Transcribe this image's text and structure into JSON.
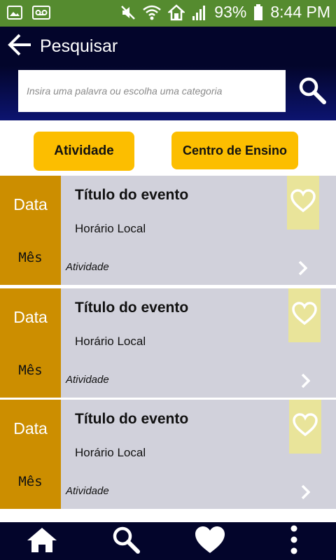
{
  "status_bar": {
    "battery": "93%",
    "time": "8:44 PM",
    "left_icons": [
      "image-icon",
      "voicemail-icon"
    ],
    "right_icons": [
      "mute-icon",
      "wifi-icon",
      "home-icon",
      "signal-icon",
      "battery-icon"
    ],
    "background": "#558b2f"
  },
  "app_bar": {
    "title": "Pesquisar",
    "back_icon": "arrow-left-icon",
    "background": "#03052b"
  },
  "search": {
    "placeholder": "Insira uma palavra ou escolha uma categoria",
    "value": "",
    "button_icon": "search-icon"
  },
  "filters": {
    "atividade_label": "Atividade",
    "centro_label": "Centro de Ensino",
    "accent": "#fcbe00"
  },
  "events": [
    {
      "day": "Data",
      "month": "Mês",
      "title": "Título do evento",
      "time_place": "Horário Local",
      "category": "Atividade",
      "favorite": false
    },
    {
      "day": "Data",
      "month": "Mês",
      "title": "Título do evento",
      "time_place": "Horário Local",
      "category": "Atividade",
      "favorite": false
    },
    {
      "day": "Data",
      "month": "Mês",
      "title": "Título do evento",
      "time_place": "Horário Local",
      "category": "Atividade",
      "favorite": false
    }
  ],
  "colors": {
    "date_block": "#cc8e00",
    "card_background": "#d1d1db",
    "favorite_background": "#e9e49a"
  },
  "bottom_nav": {
    "items": [
      "home-icon",
      "search-icon",
      "heart-icon",
      "more-vertical-icon"
    ]
  }
}
